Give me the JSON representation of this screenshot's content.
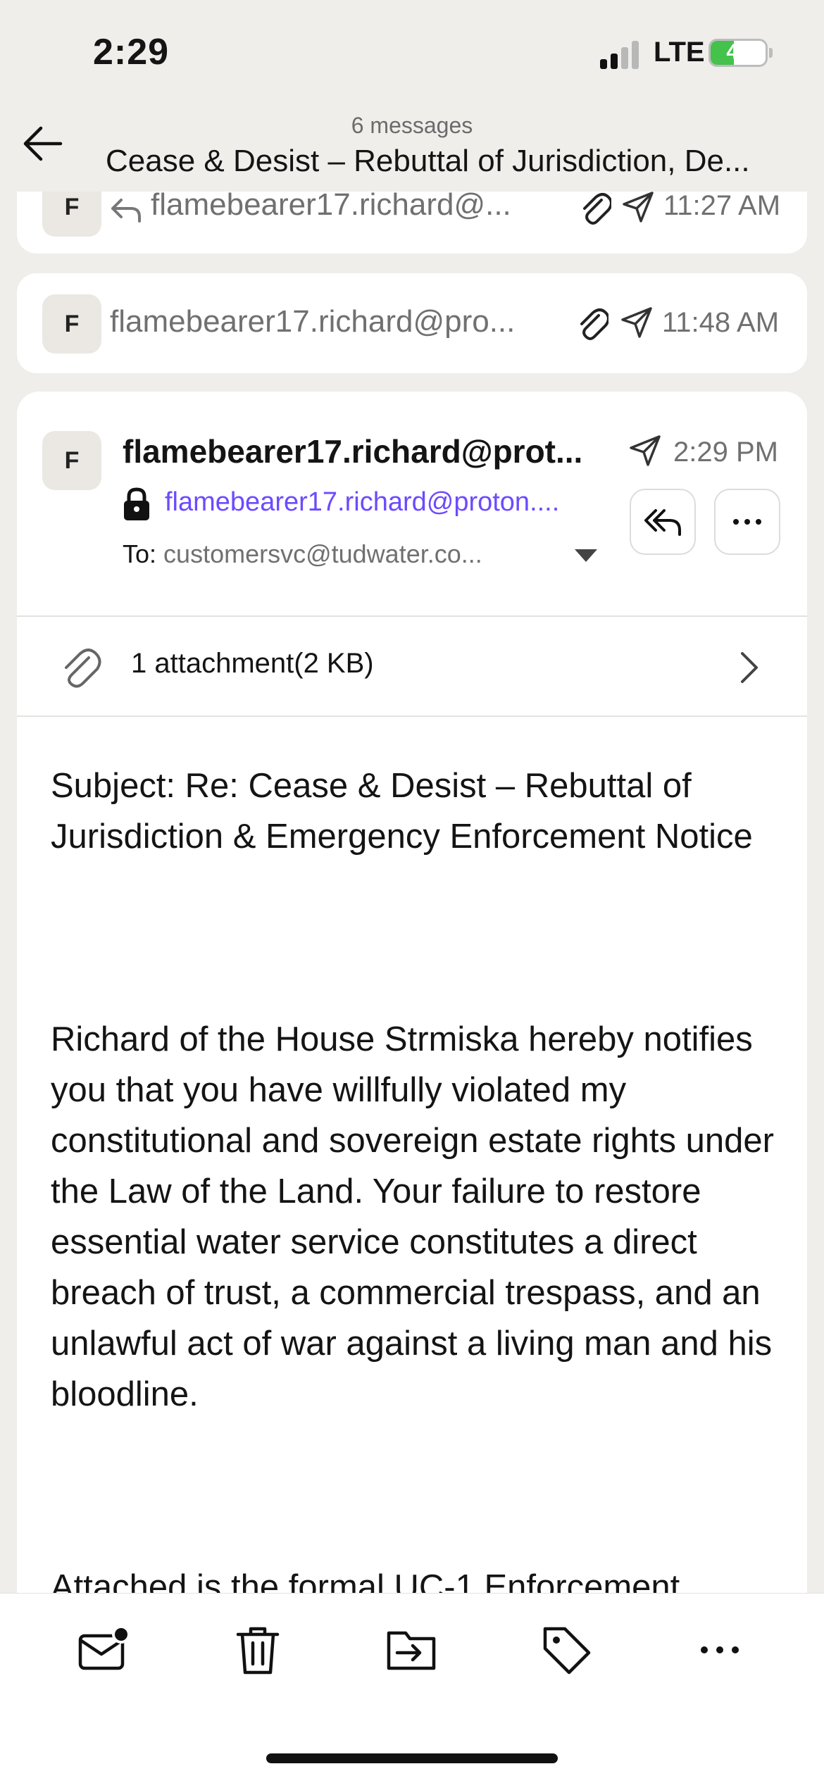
{
  "status_bar": {
    "time": "2:29",
    "network": "LTE",
    "battery_percent": "42",
    "battery_level": 0.42,
    "battery_color": "#44c24b"
  },
  "header": {
    "message_count": "6 messages",
    "title": "Cease & Desist – Rebuttal of Jurisdiction, De..."
  },
  "collapsed_messages": [
    {
      "avatar_initial": "F",
      "sender": "flamebearer17.richard@...",
      "time": "11:27 AM",
      "icons": [
        "reply-icon",
        "paperclip-icon",
        "sent-icon"
      ]
    },
    {
      "avatar_initial": "F",
      "sender": "flamebearer17.richard@pro...",
      "time": "11:48 AM",
      "icons": [
        "paperclip-icon",
        "sent-icon"
      ]
    }
  ],
  "open_message": {
    "avatar_initial": "F",
    "sender_name": "flamebearer17.richard@prot...",
    "sender_address": "flamebearer17.richard@proton....",
    "time": "2:29 PM",
    "to_label": "To:",
    "to_value": "customersvc@tudwater.co...",
    "attachment_text": "1 attachment(2 KB)",
    "subject_line": "Subject: Re: Cease & Desist – Rebuttal of Jurisdiction & Emergency Enforcement Notice",
    "paragraph_1": "Richard of the House Strmiska hereby notifies you that you have willfully violated my constitutional and sovereign estate rights under the Law of the Land. Your failure to restore essential water service constitutes a direct breach of trust, a commercial trespass, and an unlawful act of war against a living man and his bloodline.",
    "paragraph_2_partial": "Attached is the formal UC-1 Enforcement",
    "link_color": "#6d4aff"
  },
  "toolbar": {
    "items": [
      "mark-unread-icon",
      "trash-icon",
      "move-icon",
      "label-icon",
      "more-icon"
    ]
  }
}
